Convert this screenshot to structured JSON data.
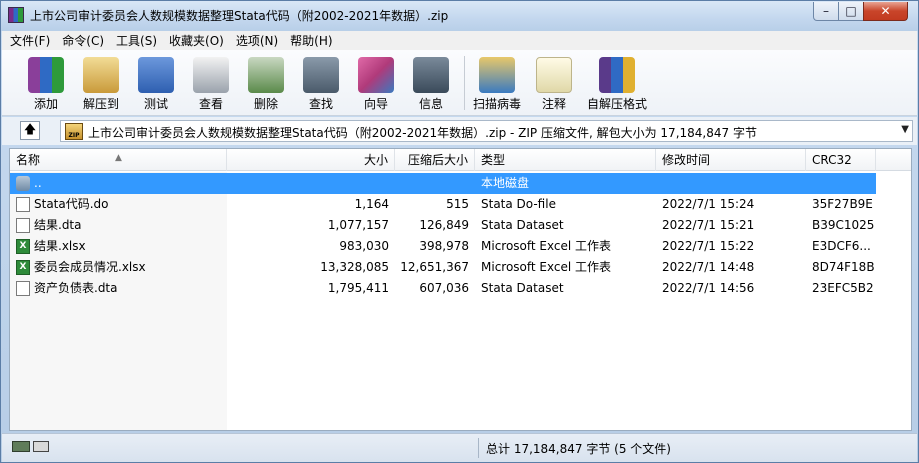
{
  "window": {
    "title": "上市公司审计委员会人数规模数据整理Stata代码（附2002-2021年数据）.zip",
    "controls": {
      "minimize": "–",
      "maximize": "□",
      "close": "✕"
    }
  },
  "menu": [
    {
      "label": "文件(F)"
    },
    {
      "label": "命令(C)"
    },
    {
      "label": "工具(S)"
    },
    {
      "label": "收藏夹(O)"
    },
    {
      "label": "选项(N)"
    },
    {
      "label": "帮助(H)"
    }
  ],
  "toolbar": [
    {
      "label": "添加",
      "icon": "add-archive-icon",
      "color": "#8a3f9a"
    },
    {
      "label": "解压到",
      "icon": "extract-to-icon",
      "color": "#c99a3a"
    },
    {
      "label": "测试",
      "icon": "test-icon",
      "color": "#2e5fb0"
    },
    {
      "label": "查看",
      "icon": "view-icon",
      "color": "#9aa2ac"
    },
    {
      "label": "删除",
      "icon": "delete-icon",
      "color": "#5a8a4a"
    },
    {
      "label": "查找",
      "icon": "find-icon",
      "color": "#4a5a6a"
    },
    {
      "label": "向导",
      "icon": "wizard-icon",
      "color": "#b03a7a"
    },
    {
      "label": "信息",
      "icon": "info-icon",
      "color": "#3a4a5a"
    },
    {
      "label": "扫描病毒",
      "icon": "virus-scan-icon",
      "color": "#3a7ac0"
    },
    {
      "label": "注释",
      "icon": "comment-icon",
      "color": "#e0d8a8"
    },
    {
      "label": "自解压格式",
      "icon": "sfx-icon",
      "color": "#5a3a8a"
    }
  ],
  "address": {
    "text": "上市公司审计委员会人数规模数据整理Stata代码（附2002-2021年数据）.zip - ZIP 压缩文件, 解包大小为 17,184,847 字节",
    "zip_badge": "ZIP"
  },
  "columns": {
    "name": "名称",
    "size": "大小",
    "packed": "压缩后大小",
    "type": "类型",
    "modified": "修改时间",
    "crc": "CRC32"
  },
  "files": [
    {
      "name": "..",
      "size": "",
      "packed": "",
      "type": "本地磁盘",
      "modified": "",
      "crc": "",
      "icon": "up-folder-icon",
      "selected": true
    },
    {
      "name": "Stata代码.do",
      "size": "1,164",
      "packed": "515",
      "type": "Stata Do-file",
      "modified": "2022/7/1 15:24",
      "crc": "35F27B9E",
      "icon": "do-file-icon"
    },
    {
      "name": "结果.dta",
      "size": "1,077,157",
      "packed": "126,849",
      "type": "Stata Dataset",
      "modified": "2022/7/1 15:21",
      "crc": "B39C1025",
      "icon": "dta-file-icon"
    },
    {
      "name": "结果.xlsx",
      "size": "983,030",
      "packed": "398,978",
      "type": "Microsoft Excel 工作表",
      "modified": "2022/7/1 15:22",
      "crc": "E3DCF6...",
      "icon": "excel-file-icon"
    },
    {
      "name": "委员会成员情况.xlsx",
      "size": "13,328,085",
      "packed": "12,651,367",
      "type": "Microsoft Excel 工作表",
      "modified": "2022/7/1 14:48",
      "crc": "8D74F18B",
      "icon": "excel-file-icon"
    },
    {
      "name": "资产负债表.dta",
      "size": "1,795,411",
      "packed": "607,036",
      "type": "Stata Dataset",
      "modified": "2022/7/1 14:56",
      "crc": "23EFC5B2",
      "icon": "dta-file-icon"
    }
  ],
  "status": {
    "text": "总计 17,184,847 字节 (5 个文件)"
  }
}
